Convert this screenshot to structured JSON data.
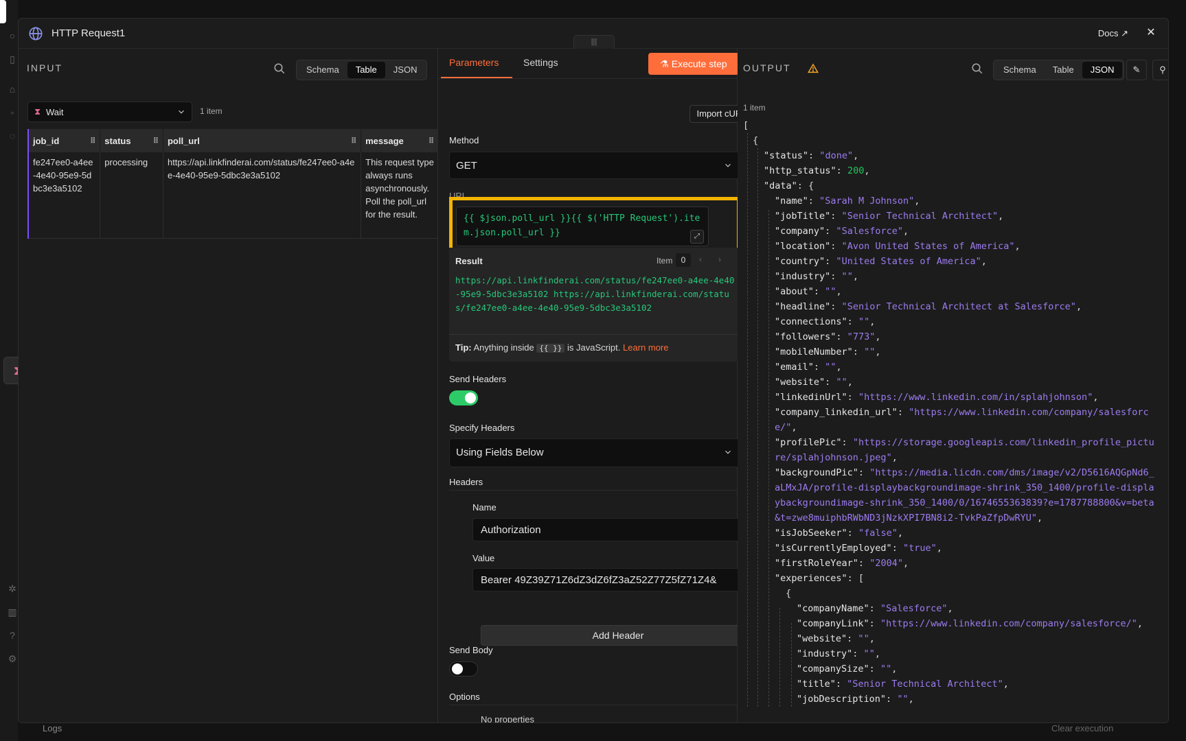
{
  "modal": {
    "title": "HTTP Request1",
    "docs_label": "Docs",
    "drag_handle": "|||"
  },
  "input": {
    "title": "INPUT",
    "view_tabs": [
      "Schema",
      "Table",
      "JSON"
    ],
    "active_view": "Table",
    "source_node": "Wait",
    "item_count": "1 item",
    "table": {
      "columns": [
        "job_id",
        "status",
        "poll_url",
        "message"
      ],
      "row": {
        "job_id": "fe247ee0-a4ee-4e40-95e9-5dbc3e3a5102",
        "status": "processing",
        "poll_url": "https://api.linkfinderai.com/status/fe247ee0-a4ee-4e40-95e9-5dbc3e3a5102",
        "message": "This request type always runs asynchronously. Poll the poll_url for the result."
      }
    }
  },
  "params": {
    "tab_parameters": "Parameters",
    "tab_settings": "Settings",
    "execute_label": "Execute step",
    "import_curl": "Import cURL",
    "method_label": "Method",
    "method_value": "GET",
    "url_label": "URL",
    "url_expression": "{{ $json.poll_url }}{{ $('HTTP Request').item.json.poll_url }}",
    "result_label": "Result",
    "item_label": "Item",
    "item_index": "0",
    "result_value": "https://api.linkfinderai.com/status/fe247ee0-a4ee-4e40-95e9-5dbc3e3a5102 https://api.linkfinderai.com/status/fe247ee0-a4ee-4e40-95e9-5dbc3e3a5102",
    "tip_prefix": "Tip:",
    "tip_text": "Anything inside",
    "tip_code": "{{ }}",
    "tip_suffix": "is JavaScript.",
    "tip_link": "Learn more",
    "send_headers_label": "Send Headers",
    "send_headers_on": true,
    "specify_headers_label": "Specify Headers",
    "specify_headers_value": "Using Fields Below",
    "headers_label": "Headers",
    "header_name_label": "Name",
    "header_name_value": "Authorization",
    "header_value_label": "Value",
    "header_value_value": "Bearer 49Z39Z71Z6dZ3dZ6fZ3aZ52Z77Z5fZ71Z4&",
    "add_header": "Add Header",
    "send_body_label": "Send Body",
    "send_body_on": false,
    "options_label": "Options",
    "no_properties": "No properties"
  },
  "output": {
    "title": "OUTPUT",
    "view_tabs": [
      "Schema",
      "Table",
      "JSON"
    ],
    "active_view": "JSON",
    "item_count": "1 item",
    "json": {
      "status": "done",
      "http_status": "200",
      "name": "Sarah M Johnson",
      "jobTitle": "Senior Technical Architect",
      "company": "Salesforce",
      "location": "Avon United States of America",
      "country": "United States of America",
      "industry": "",
      "about": "",
      "headline": "Senior Technical Architect at Salesforce",
      "connections": "",
      "followers": "773",
      "mobileNumber": "",
      "email": "",
      "website": "",
      "linkedinUrl": "https://www.linkedin.com/in/splahjohnson",
      "company_linkedin_url": "https://www.linkedin.com/company/salesforce/",
      "profilePic": "https://storage.googleapis.com/linkedin_profile_picture/splahjohnson.jpeg",
      "backgroundPic": "https://media.licdn.com/dms/image/v2/D5616AQGpNd6_aLMxJA/profile-displaybackgroundimage-shrink_350_1400/profile-displaybackgroundimage-shrink_350_1400/0/1674655363839?e=1787788800&v=beta&t=zwe8muiphbRWbND3jNzkXPI7BN8i2-TvkPaZfpDwRYU",
      "isJobSeeker": "false",
      "isCurrentlyEmployed": "true",
      "firstRoleYear": "2004",
      "exp_companyName": "Salesforce",
      "exp_companyLink": "https://www.linkedin.com/company/salesforce/",
      "exp_website": "",
      "exp_industry": "",
      "exp_companySize": "",
      "exp_title": "Senior Technical Architect",
      "exp_jobDescription": ""
    }
  },
  "footer": {
    "logs": "Logs",
    "clear_execution": "Clear execution"
  },
  "colors": {
    "accent": "#ff6d3b",
    "highlight": "#f5b400",
    "json_string": "#9d7cf0",
    "json_number": "#22c55e",
    "toggle_on": "#2dcb67"
  }
}
